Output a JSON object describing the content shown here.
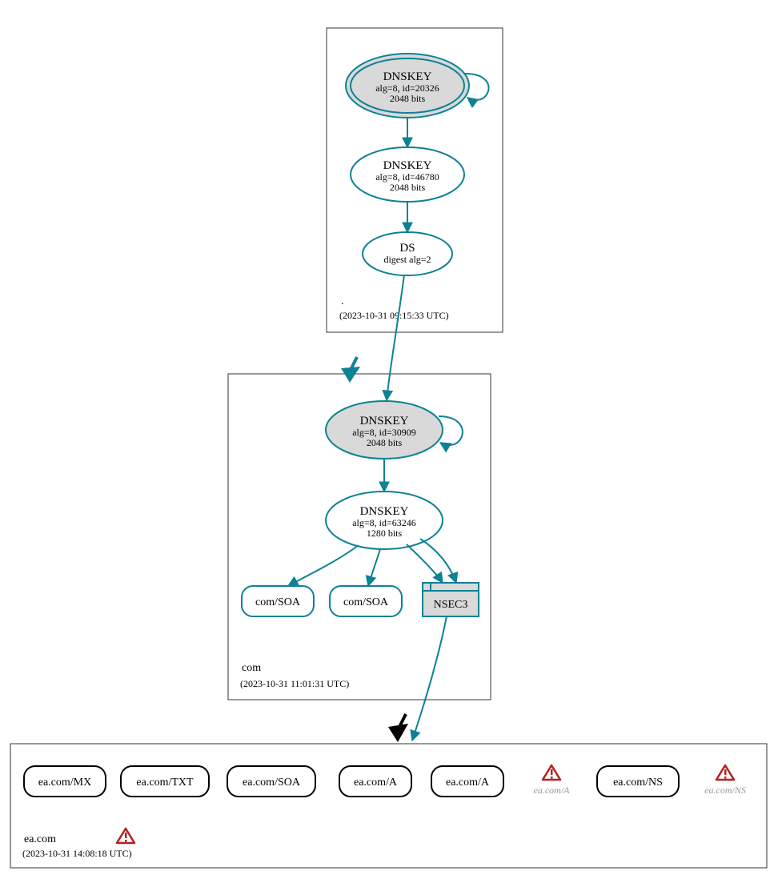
{
  "zones": {
    "root": {
      "name": ".",
      "timestamp": "(2023-10-31 09:15:33 UTC)",
      "dnskey1": {
        "title": "DNSKEY",
        "line1": "alg=8, id=20326",
        "line2": "2048 bits"
      },
      "dnskey2": {
        "title": "DNSKEY",
        "line1": "alg=8, id=46780",
        "line2": "2048 bits"
      },
      "ds": {
        "title": "DS",
        "line1": "digest alg=2"
      }
    },
    "com": {
      "name": "com",
      "timestamp": "(2023-10-31 11:01:31 UTC)",
      "dnskey1": {
        "title": "DNSKEY",
        "line1": "alg=8, id=30909",
        "line2": "2048 bits"
      },
      "dnskey2": {
        "title": "DNSKEY",
        "line1": "alg=8, id=63246",
        "line2": "1280 bits"
      },
      "rr1": "com/SOA",
      "rr2": "com/SOA",
      "nsec3": "NSEC3"
    },
    "ea": {
      "name": "ea.com",
      "timestamp": "(2023-10-31 14:08:18 UTC)",
      "records": [
        "ea.com/MX",
        "ea.com/TXT",
        "ea.com/SOA",
        "ea.com/A",
        "ea.com/A",
        "ea.com/A",
        "ea.com/NS",
        "ea.com/NS"
      ]
    }
  }
}
